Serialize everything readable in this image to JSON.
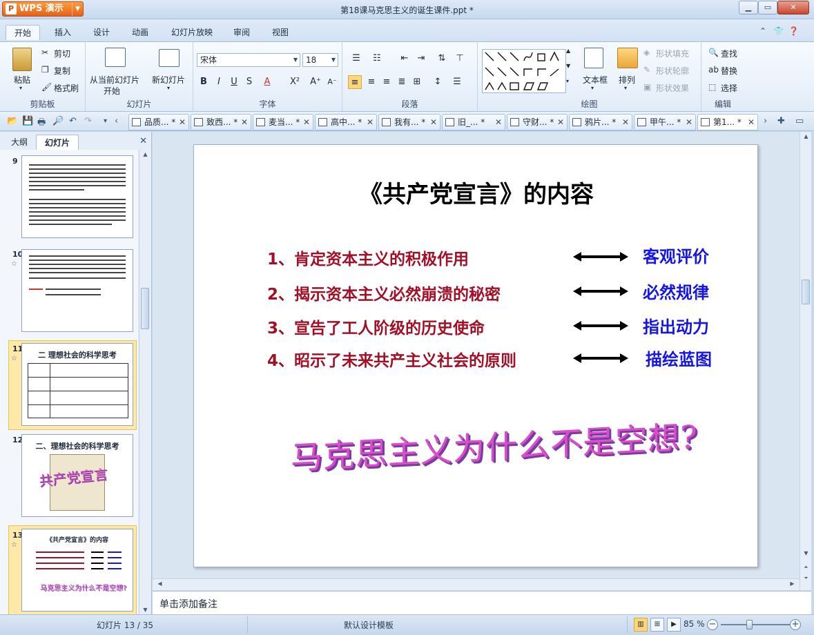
{
  "window": {
    "app_button": "WPS 演示",
    "title": "第18课马克思主义的诞生课件.ppt *"
  },
  "menu": {
    "tabs": [
      "开始",
      "插入",
      "设计",
      "动画",
      "幻灯片放映",
      "审阅",
      "视图"
    ],
    "active": "开始"
  },
  "ribbon": {
    "clipboard": {
      "paste": "粘贴",
      "cut": "剪切",
      "copy": "复制",
      "format_painter": "格式刷",
      "label": "剪贴板"
    },
    "slides": {
      "from_current": "从当前幻灯片",
      "start": "开始",
      "new_slide": "新幻灯片",
      "label": "幻灯片"
    },
    "font": {
      "name": "宋体",
      "size": "18",
      "label": "字体"
    },
    "paragraph": {
      "label": "段落"
    },
    "drawing": {
      "textbox": "文本框",
      "arrange": "排列",
      "fill": "形状填充",
      "outline": "形状轮廓",
      "effects": "形状效果",
      "label": "绘图"
    },
    "edit": {
      "find": "查找",
      "replace": "替换",
      "select": "选择",
      "label": "编辑"
    }
  },
  "doc_tabs": [
    "品质... *",
    "致西... *",
    "麦当... *",
    "高中... *",
    "我有... *",
    "旧_... *",
    "守财... *",
    "鸦片... *",
    "甲午... *",
    "第1... *"
  ],
  "panel": {
    "tabs": [
      "大纲",
      "幻灯片"
    ],
    "active": "幻灯片",
    "thumbs": [
      {
        "number": "9"
      },
      {
        "number": "10",
        "star": "☆"
      },
      {
        "number": "11",
        "star": "☆",
        "title": "二 理想社会的科学思考"
      },
      {
        "number": "12",
        "title": "二、理想社会的科学思考",
        "wordart": "共产党宣言"
      },
      {
        "number": "13",
        "star": "☆",
        "title": "《共产党宣言》的内容",
        "wordart": "马克思主义为什么不是空想?"
      }
    ]
  },
  "slide": {
    "title": "《共产党宣言》的内容",
    "points": [
      {
        "left": "1、肯定资本主义的积极作用",
        "right": "客观评价"
      },
      {
        "left": "2、揭示资本主义必然崩溃的秘密",
        "right": "必然规律"
      },
      {
        "left": "3、宣告了工人阶级的历史使命",
        "right": "指出动力"
      },
      {
        "left": "4、昭示了未来共产主义社会的原则",
        "right": "描绘蓝图"
      }
    ],
    "wordart": "马克思主义为什么不是空想?"
  },
  "notes": {
    "placeholder": "单击添加备注"
  },
  "status": {
    "slide_counter": "幻灯片 13 / 35",
    "template": "默认设计模板",
    "zoom": "85 %",
    "zoom_fraction": 0.38
  },
  "colors": {
    "point_left": "#a11026",
    "point_right": "#1515e6",
    "wordart": "#d94fc9"
  }
}
